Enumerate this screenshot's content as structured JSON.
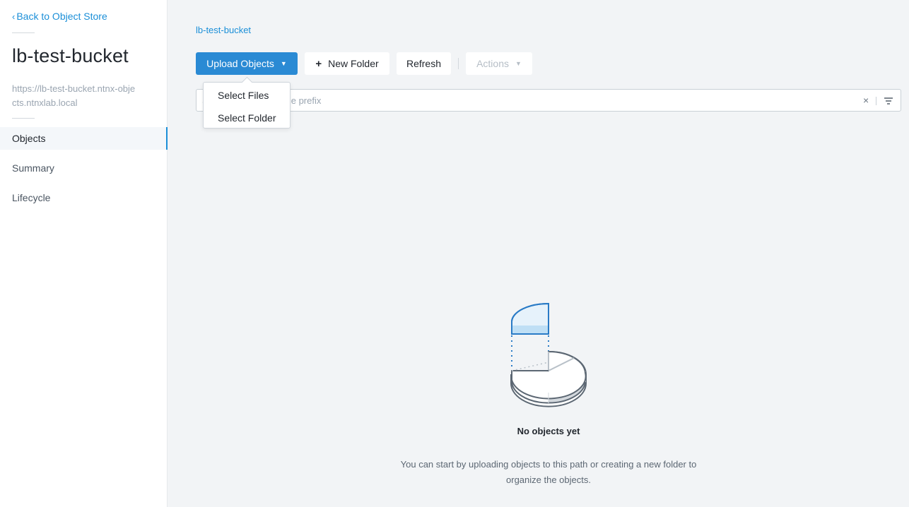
{
  "sidebar": {
    "back_label": "Back to Object Store",
    "bucket_name": "lb-test-bucket",
    "bucket_url": "https://lb-test-bucket.ntnx-objects.ntnxlab.local",
    "nav": [
      {
        "label": "Objects",
        "active": true
      },
      {
        "label": "Summary",
        "active": false
      },
      {
        "label": "Lifecycle",
        "active": false
      }
    ]
  },
  "breadcrumb": "lb-test-bucket",
  "toolbar": {
    "upload_label": "Upload Objects",
    "new_folder_label": "New Folder",
    "refresh_label": "Refresh",
    "actions_label": "Actions"
  },
  "upload_menu": {
    "items": [
      "Select Files",
      "Select Folder"
    ]
  },
  "search": {
    "placeholder": "Search by object name prefix",
    "value": ""
  },
  "empty_state": {
    "title": "No objects yet",
    "description": "You can start by uploading objects to this path or creating a new folder to organize the objects."
  },
  "colors": {
    "accent": "#1b8fd8",
    "primary_button": "#2a8ad4",
    "background": "#f2f4f6"
  }
}
